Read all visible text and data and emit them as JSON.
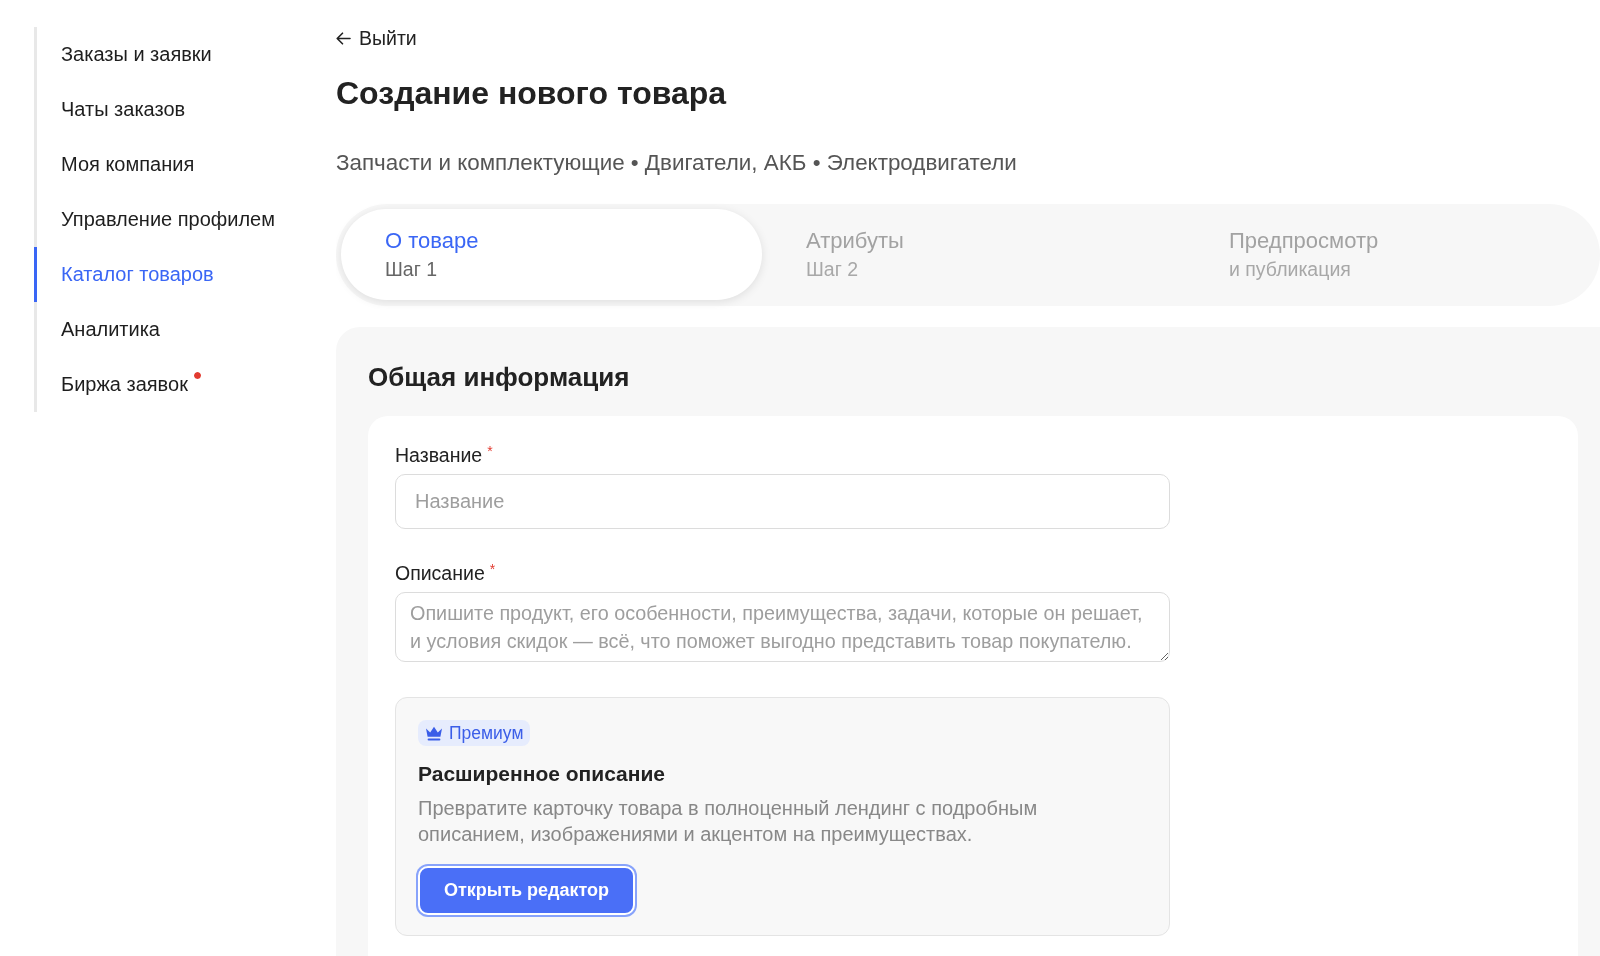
{
  "sidebar": {
    "items": [
      {
        "label": "Заказы и заявки",
        "selected": false,
        "unread": false
      },
      {
        "label": "Чаты заказов",
        "selected": false,
        "unread": false
      },
      {
        "label": "Моя компания",
        "selected": false,
        "unread": false
      },
      {
        "label": "Управление профилем",
        "selected": false,
        "unread": false
      },
      {
        "label": "Каталог товаров",
        "selected": true,
        "unread": false
      },
      {
        "label": "Аналитика",
        "selected": false,
        "unread": false
      },
      {
        "label": "Биржа заявок",
        "selected": false,
        "unread": true
      }
    ]
  },
  "header": {
    "back_link": "Выйти",
    "title": "Создание нового товара",
    "category_path": "Запчасти и комплектующие • Двигатели, АКБ • Электродвигатели"
  },
  "steps": [
    {
      "label": "О товаре",
      "subtitle": "Шаг 1",
      "selected": true
    },
    {
      "label": "Атрибуты",
      "subtitle": "Шаг 2",
      "selected": false
    },
    {
      "label": "Предпросмотр",
      "subtitle": "и публикация",
      "selected": false
    }
  ],
  "general_info": {
    "title": "Общая информация",
    "fields": [
      {
        "kind": "input",
        "label": "Название",
        "required_mark": "*",
        "placeholder": "Название"
      },
      {
        "kind": "textarea",
        "label": "Описание",
        "required_mark": "*",
        "placeholder": "Опишите продукт, его особенности, преимущества, задачи, которые он решает, и условия скидок — всё, что поможет выгодно представить товар покупателю."
      }
    ],
    "premium": {
      "badge": "Премиум",
      "title": "Расширенное описание",
      "description": "Превратите карточку товара в полноценный лендинг с подробным описанием, изображениями и акцентом на преимуществах.",
      "button": "Открыть редактор"
    }
  }
}
